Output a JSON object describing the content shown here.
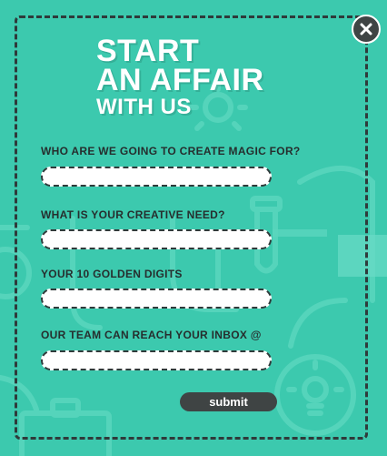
{
  "modal": {
    "headline": {
      "line1": "START",
      "line2": "AN AFFAIR",
      "line3": "WITH US"
    },
    "close_icon": "close-icon",
    "fields": [
      {
        "label": "WHO ARE WE GOING TO CREATE MAGIC FOR?",
        "value": "",
        "placeholder": ""
      },
      {
        "label": "WHAT IS YOUR CREATIVE NEED?",
        "value": "",
        "placeholder": ""
      },
      {
        "label": "YOUR 10 GOLDEN DIGITS",
        "value": "",
        "placeholder": ""
      },
      {
        "label": "OUR TEAM CAN REACH YOUR INBOX @",
        "value": "",
        "placeholder": ""
      }
    ],
    "submit_label": "submit"
  },
  "colors": {
    "background": "#3cc9ae",
    "dark": "#3f4444",
    "text_dark": "#262e2e",
    "white": "#ffffff"
  },
  "decorations": [
    "lightbulb-icon",
    "test-tube-icon",
    "flask-icon",
    "clipboard-icon",
    "gear-icon"
  ]
}
